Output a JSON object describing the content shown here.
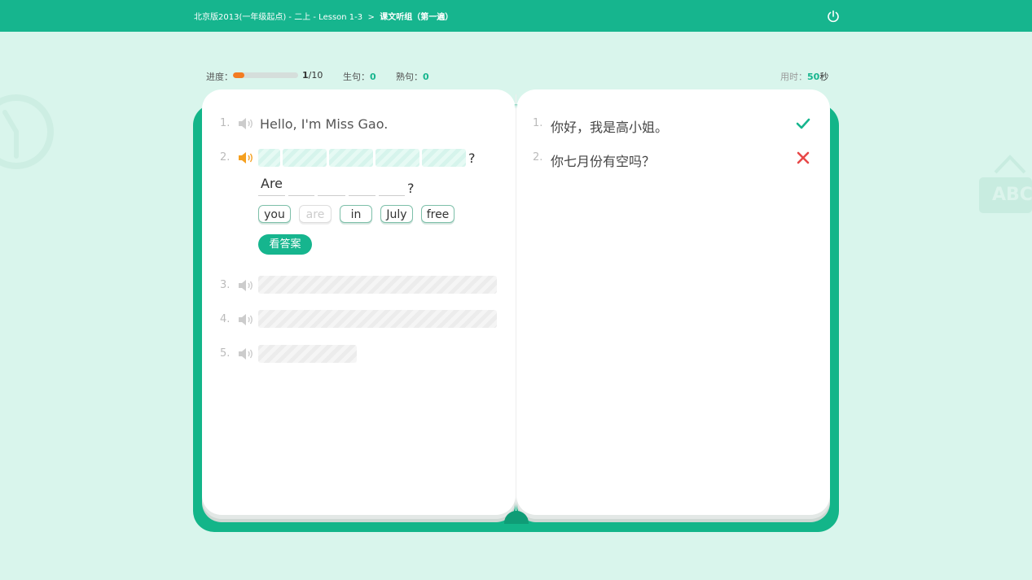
{
  "header": {
    "breadcrumb": "北京版2013(一年级起点) - 二上 - Lesson 1-3",
    "separator": ">",
    "current": "课文听组（第一遍）",
    "power_icon": "power-icon"
  },
  "stats": {
    "progress_label": "进度：",
    "progress_value": 0.1,
    "progress_current": "1",
    "progress_total": "/10",
    "new_label": "生句：",
    "new_value": "0",
    "familiar_label": "熟句：",
    "familiar_value": "0",
    "time_label": "用时：",
    "time_value": "50",
    "time_unit": "秒"
  },
  "left_page": {
    "items": [
      {
        "num": "1.",
        "text": "Hello, I'm Miss Gao."
      },
      {
        "num": "2.",
        "end": "?"
      },
      {
        "num": "3."
      },
      {
        "num": "4."
      },
      {
        "num": "5."
      }
    ],
    "answer": {
      "first_word": "Are",
      "end": "?"
    },
    "chips": [
      {
        "word": "you",
        "used": false
      },
      {
        "word": "are",
        "used": true
      },
      {
        "word": "in",
        "used": false
      },
      {
        "word": "July",
        "used": false
      },
      {
        "word": "free",
        "used": false
      }
    ],
    "see_answer": "看答案"
  },
  "right_page": {
    "items": [
      {
        "num": "1.",
        "text": "你好，我是高小姐。",
        "result": "correct"
      },
      {
        "num": "2.",
        "text": "你七月份有空吗？",
        "result": "wrong"
      }
    ]
  },
  "decorations": {
    "abc": "ABC"
  },
  "colors": {
    "accent": "#16b58e",
    "progress": "#f37c22",
    "wrong": "#e84848",
    "speaker_active": "#f5a020"
  }
}
